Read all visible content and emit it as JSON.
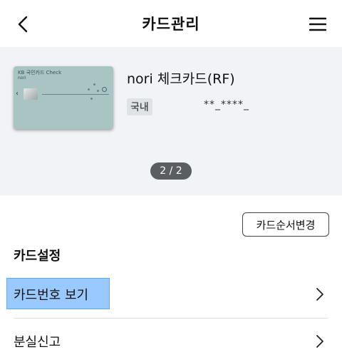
{
  "header": {
    "title": "카드관리",
    "back_icon": "chevron-left-icon",
    "menu_icon": "hamburger-menu-icon"
  },
  "card": {
    "brand_text": "KB 국민카드  Check",
    "owner_text": "nori",
    "name": "nori 체크카드(RF)",
    "type_badge": "국내",
    "number": "**_****_",
    "page_indicator": "2 / 2",
    "card_color": "#a8c5c4"
  },
  "actions": {
    "order_change_label": "카드순서변경"
  },
  "settings": {
    "title": "카드설정",
    "items": [
      {
        "label": "카드번호 보기",
        "icon": "chevron-right-icon",
        "highlighted": true
      },
      {
        "label": "분실신고",
        "icon": "chevron-right-icon",
        "highlighted": false
      }
    ]
  },
  "colors": {
    "highlight": "#99c9ff",
    "card_area_bg": "#f2f3f6",
    "indicator_bg": "#5a5d62"
  }
}
